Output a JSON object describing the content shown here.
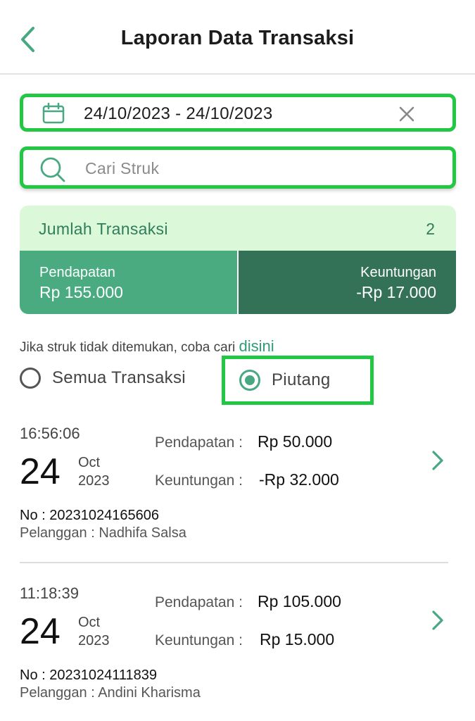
{
  "header": {
    "title": "Laporan Data Transaksi",
    "back_icon": "chevron-left-icon"
  },
  "date_filter": {
    "value": "24/10/2023 - 24/10/2023",
    "icon": "calendar-icon",
    "clear_icon": "close-icon"
  },
  "search": {
    "placeholder": "Cari Struk",
    "value": "",
    "icon": "search-icon"
  },
  "summary": {
    "count_label": "Jumlah Transaksi",
    "count_value": "2",
    "income_label": "Pendapatan",
    "income_value": "Rp 155.000",
    "profit_label": "Keuntungan",
    "profit_value": "-Rp 17.000"
  },
  "hint": {
    "text": "Jika struk tidak ditemukan, coba cari",
    "link": "disini"
  },
  "filters": {
    "options": [
      {
        "label": "Semua Transaksi",
        "selected": false
      },
      {
        "label": "Piutang",
        "selected": true
      }
    ]
  },
  "transactions": [
    {
      "time": "16:56:06",
      "day": "24",
      "month": "Oct",
      "year": "2023",
      "income_label": "Pendapatan :",
      "income_value": "Rp 50.000",
      "profit_label": "Keuntungan :",
      "profit_value": "-Rp 32.000",
      "number": "No : 20231024165606",
      "customer": "Pelanggan : Nadhifa Salsa"
    },
    {
      "time": "11:18:39",
      "day": "24",
      "month": "Oct",
      "year": "2023",
      "income_label": "Pendapatan :",
      "income_value": "Rp 105.000",
      "profit_label": "Keuntungan :",
      "profit_value": "Rp 15.000",
      "number": "No : 20231024111839",
      "customer": "Pelanggan : Andini Kharisma"
    }
  ],
  "colors": {
    "primary": "#48a882",
    "primary_dark": "#347258",
    "primary_light": "#dbf8d9",
    "highlight": "#22c744"
  }
}
